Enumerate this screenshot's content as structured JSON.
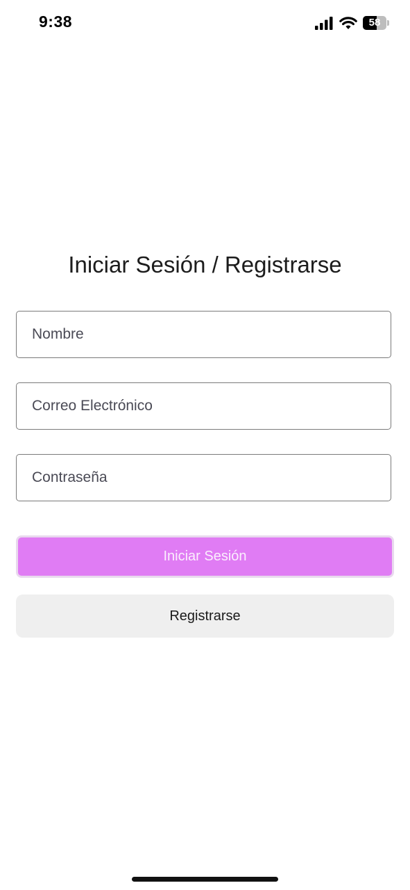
{
  "status_bar": {
    "time": "9:38",
    "battery_level": "58",
    "battery_fraction": 0.58,
    "icons": [
      "signal-icon",
      "wifi-icon",
      "battery-icon"
    ]
  },
  "auth": {
    "title": "Iniciar Sesión / Registrarse",
    "fields": {
      "name_placeholder": "Nombre",
      "email_placeholder": "Correo Electrónico",
      "password_placeholder": "Contraseña"
    },
    "login_label": "Iniciar Sesión",
    "register_label": "Registrarse"
  },
  "colors": {
    "login_button_bg": "#e07cf4",
    "register_button_bg": "#efefef",
    "field_border": "#7a7a7a"
  }
}
